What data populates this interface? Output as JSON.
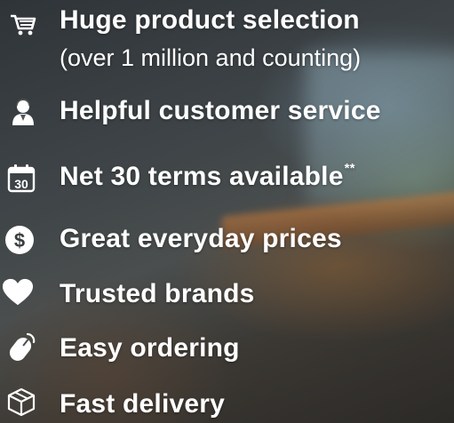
{
  "features": [
    {
      "icon": "shopping-cart-icon",
      "title": "Huge product selection",
      "subtitle": "(over 1 million and counting)"
    },
    {
      "icon": "customer-service-agent-icon",
      "title": "Helpful customer service"
    },
    {
      "icon": "calendar-30-icon",
      "title": "Net 30 terms available",
      "title_sup": "**",
      "icon_text": "30"
    },
    {
      "icon": "dollar-circle-icon",
      "title": "Great everyday prices",
      "icon_text": "$"
    },
    {
      "icon": "heart-icon",
      "title": "Trusted brands"
    },
    {
      "icon": "computer-mouse-icon",
      "title": "Easy ordering"
    },
    {
      "icon": "package-box-icon",
      "title": "Fast delivery"
    }
  ]
}
